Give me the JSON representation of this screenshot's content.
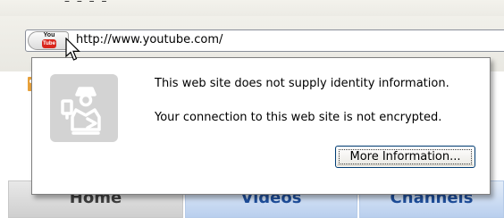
{
  "browser": {
    "menu_fragment": "– – – –",
    "address_bar": {
      "url": "http://www.youtube.com/",
      "site_icon": "youtube-logo-icon",
      "logo_text_top": "You",
      "logo_text_bottom": "Tube"
    }
  },
  "identity_popup": {
    "icon": "passport-officer-icon",
    "identity_message": "This web site does not supply identity information.",
    "encryption_message": "Your connection to this web site is not encrypted.",
    "more_info_label": "More Information..."
  },
  "page_tabs": [
    {
      "label": "Home"
    },
    {
      "label": "Videos"
    },
    {
      "label": "Channels"
    }
  ],
  "colors": {
    "youtube_red": "#d9261c",
    "tab_text_blue": "#1e4e9b",
    "button_border": "#003c74"
  }
}
